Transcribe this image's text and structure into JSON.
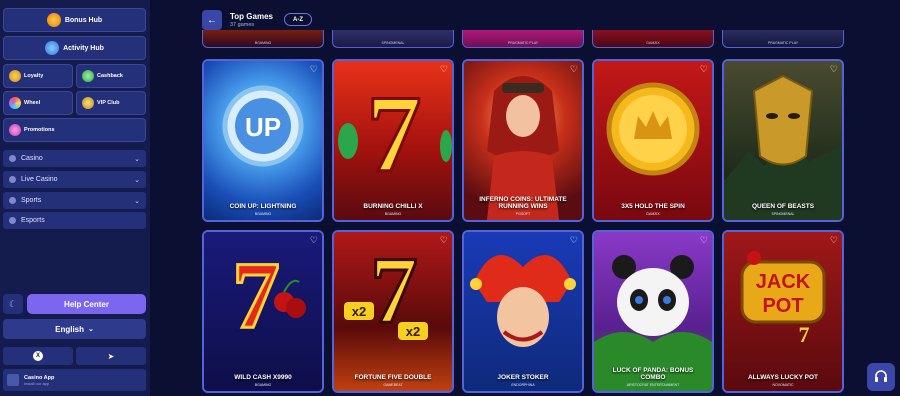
{
  "sidebar": {
    "bonus_hub": "Bonus Hub",
    "activity_hub": "Activity Hub",
    "loyalty": "Loyalty",
    "cashback": "Cashback",
    "wheel": "Wheel",
    "vip_club": "VIP Club",
    "promotions": "Promotions",
    "nav": [
      {
        "label": "Casino"
      },
      {
        "label": "Live Casino"
      },
      {
        "label": "Sports"
      },
      {
        "label": "Esports"
      }
    ],
    "help_center": "Help Center",
    "language": "English",
    "app_title": "Casino App",
    "app_subtitle": "Install our app"
  },
  "header": {
    "title": "Top Games",
    "subtitle": "37 games",
    "sort": "A-Z"
  },
  "peek_providers": [
    "BGAMING",
    "SPINOMENAL",
    "PRAGMATIC PLAY",
    "GAMZIX",
    "PRAGMATIC PLAY"
  ],
  "games": [
    {
      "name": "COIN UP: LIGHTNING",
      "provider": "BGAMING"
    },
    {
      "name": "BURNING CHILLI X",
      "provider": "BGAMING"
    },
    {
      "name": "INFERNO COINS: ULTIMATE RUNNING WINS",
      "provider": "PGSOFT"
    },
    {
      "name": "3X5 HOLD THE SPIN",
      "provider": "GAMZIX"
    },
    {
      "name": "QUEEN OF BEASTS",
      "provider": "SPINOMENAL"
    },
    {
      "name": "WILD CASH X9990",
      "provider": "BGAMING"
    },
    {
      "name": "FORTUNE FIVE DOUBLE",
      "provider": "GAMEBEAT"
    },
    {
      "name": "JOKER STOKER",
      "provider": "ENDORPHINA"
    },
    {
      "name": "LUCK OF PANDA: BONUS COMBO",
      "provider": "ARISTOCRAT ENTERTAINMENT"
    },
    {
      "name": "ALLWAYS LUCKY POT",
      "provider": "NOVOMATIC"
    }
  ],
  "icons": {
    "heart": "heart-icon",
    "back": "arrow-left-icon",
    "support": "headset-icon"
  },
  "colors": {
    "background": "#0b1033",
    "sidebar": "#141c4d",
    "accent": "#7a66ef",
    "card_border": "#5562d9"
  }
}
